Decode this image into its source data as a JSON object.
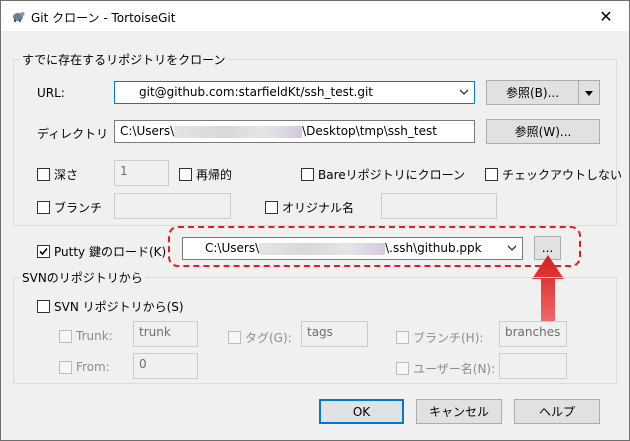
{
  "window": {
    "title": "Git クローン - TortoiseGit",
    "close_glyph": "✕"
  },
  "clone_group": {
    "title": "すでに存在するリポジトリをクローン",
    "url_label": "URL:",
    "url_value": "git@github.com:starfieldKt/ssh_test.git",
    "browse_url_label": "参照(B)...",
    "dir_label": "ディレクトリ",
    "dir_value_prefix": "C:\\Users\\",
    "dir_value_suffix": "\\Desktop\\tmp\\ssh_test",
    "browse_dir_label": "参照(W)...",
    "depth_label": "深さ",
    "depth_value": "1",
    "recursive_label": "再帰的",
    "bare_label": "Bareリポジトリにクローン",
    "no_checkout_label": "チェックアウトしない",
    "branch_label": "ブランチ",
    "origin_label": "オリジナル名"
  },
  "putty": {
    "label": "Putty 鍵のロード(K)",
    "checked": true,
    "value_prefix": "C:\\Users\\",
    "value_suffix": "\\.ssh\\github.ppk",
    "browse_label": "..."
  },
  "svn_group": {
    "title": "SVNのリポジトリから",
    "from_svn_label": "SVN リポジトリから(S)",
    "trunk_label": "Trunk:",
    "trunk_value": "trunk",
    "tags_label": "タグ(G):",
    "tags_value": "tags",
    "branch_label": "ブランチ(H):",
    "branch_value": "branches",
    "from_label": "From:",
    "from_value": "0",
    "username_label": "ユーザー名(N):"
  },
  "buttons": {
    "ok": "OK",
    "cancel": "キャンセル",
    "help": "ヘルプ"
  },
  "colors": {
    "highlight": "#e02020",
    "arrow": "#e53030",
    "focus": "#0078d7"
  }
}
